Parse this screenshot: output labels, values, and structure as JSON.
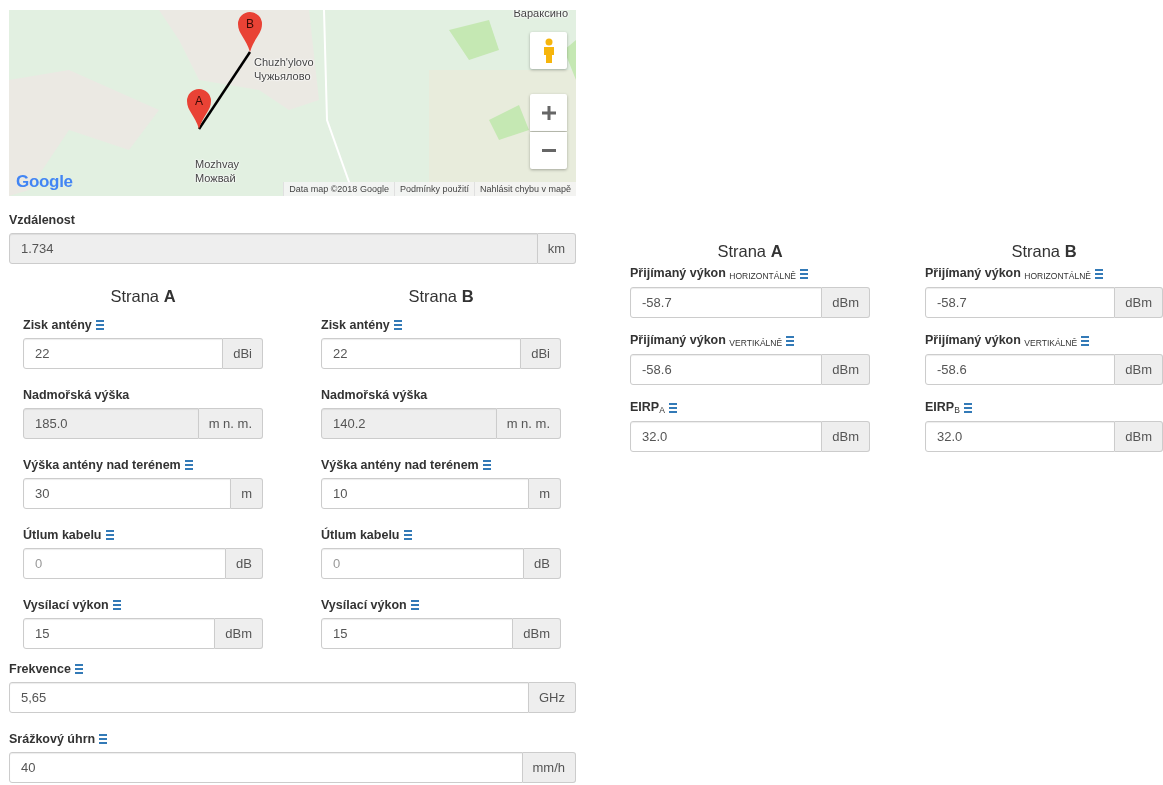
{
  "map": {
    "places": [
      "Вараксино",
      "Chuzh'ylovo",
      "Чужьялово",
      "Mozhvay",
      "Можвай"
    ],
    "markers": [
      "A",
      "B"
    ],
    "logo": "Google",
    "attribution": [
      "Data map ©2018 Google",
      "Podmínky použití",
      "Nahlásit chybu v mapě"
    ]
  },
  "distance": {
    "label": "Vzdálenost",
    "value": "1.734",
    "unit": "km",
    "readonly": true,
    "info": false
  },
  "sides": [
    {
      "heading": "Strana **A**",
      "fields": [
        {
          "label": "Zisk antény",
          "info": true,
          "value": "22",
          "unit": "dBi",
          "readonly": false
        },
        {
          "label": "Nadmořská výška",
          "info": false,
          "value": "185.0",
          "unit": "m n. m.",
          "readonly": true
        },
        {
          "label": "Výška antény nad terénem",
          "info": true,
          "value": "30",
          "unit": "m",
          "readonly": false
        },
        {
          "label": "Útlum kabelu",
          "info": true,
          "placeholder": "0",
          "unit": "dB",
          "readonly": false
        },
        {
          "label": "Vysílací výkon",
          "info": true,
          "value": "15",
          "unit": "dBm",
          "readonly": false
        }
      ]
    },
    {
      "heading": "Strana **B**",
      "fields": [
        {
          "label": "Zisk antény",
          "info": true,
          "value": "22",
          "unit": "dBi",
          "readonly": false
        },
        {
          "label": "Nadmořská výška",
          "info": false,
          "value": "140.2",
          "unit": "m n. m.",
          "readonly": true
        },
        {
          "label": "Výška antény nad terénem",
          "info": true,
          "value": "10",
          "unit": "m",
          "readonly": false
        },
        {
          "label": "Útlum kabelu",
          "info": true,
          "placeholder": "0",
          "unit": "dB",
          "readonly": false
        },
        {
          "label": "Vysílací výkon",
          "info": true,
          "value": "15",
          "unit": "dBm",
          "readonly": false
        }
      ]
    }
  ],
  "link_fields": [
    {
      "label": "Frekvence",
      "info": true,
      "value": "5,65",
      "unit": "GHz",
      "readonly": false
    },
    {
      "label": "Srážkový úhrn",
      "info": true,
      "value": "40",
      "unit": "mm/h",
      "readonly": false
    }
  ],
  "results": [
    {
      "heading": "Strana **A**",
      "fields": [
        {
          "label": "Přijímaný výkon $_{HORIZONTÁLNĚ}$",
          "info": true,
          "value": "-58.7",
          "unit": "dBm",
          "readonly": false
        },
        {
          "label": "Přijímaný výkon $_{VERTIKÁLNĚ}$",
          "info": true,
          "value": "-58.6",
          "unit": "dBm",
          "readonly": false
        },
        {
          "label": "EIRP$_{A}$",
          "info": true,
          "value": "32.0",
          "unit": "dBm",
          "readonly": false
        }
      ]
    },
    {
      "heading": "Strana **B**",
      "fields": [
        {
          "label": "Přijímaný výkon $_{HORIZONTÁLNĚ}$",
          "info": true,
          "value": "-58.7",
          "unit": "dBm",
          "readonly": false
        },
        {
          "label": "Přijímaný výkon $_{VERTIKÁLNĚ}$",
          "info": true,
          "value": "-58.6",
          "unit": "dBm",
          "readonly": false
        },
        {
          "label": "EIRP$_{B}$",
          "info": true,
          "value": "32.0",
          "unit": "dBm",
          "readonly": false
        }
      ]
    }
  ]
}
